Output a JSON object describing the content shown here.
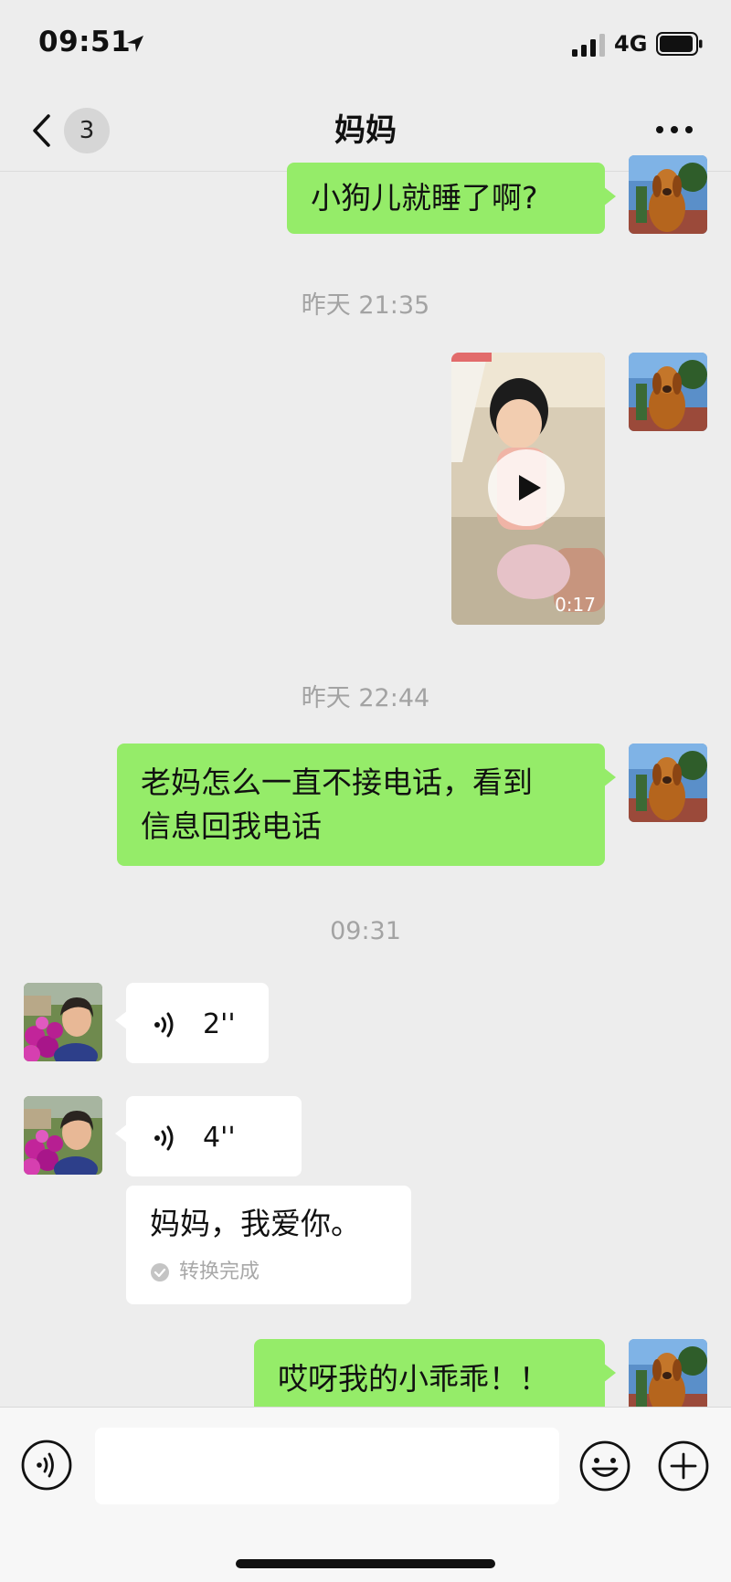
{
  "status_bar": {
    "time": "09:51",
    "network": "4G",
    "icons": [
      "location-arrow-icon",
      "signal-icon",
      "battery-icon"
    ]
  },
  "header": {
    "back_icon": "chevron-left-icon",
    "unread_count": "3",
    "title": "妈妈",
    "more_icon": "more-dots-icon"
  },
  "messages": [
    {
      "type": "text",
      "direction": "out",
      "text": "小狗儿就睡了啊?"
    },
    {
      "type": "timestamp",
      "text": "昨天 21:35"
    },
    {
      "type": "video",
      "direction": "out",
      "duration": "0:17"
    },
    {
      "type": "timestamp",
      "text": "昨天 22:44"
    },
    {
      "type": "text",
      "direction": "out",
      "lines": [
        "老妈怎么一直不接电话，看到",
        "信息回我电话"
      ]
    },
    {
      "type": "timestamp",
      "text": "09:31"
    },
    {
      "type": "voice",
      "direction": "in",
      "duration": "2''"
    },
    {
      "type": "voice",
      "direction": "in",
      "duration": "4''",
      "transcript": "妈妈，我爱你。",
      "transcript_status": "转换完成"
    },
    {
      "type": "text",
      "direction": "out",
      "text": "哎呀我的小乖乖！！"
    }
  ],
  "input_bar": {
    "placeholder": "",
    "icons": [
      "voice-toggle-icon",
      "emoji-icon",
      "plus-icon"
    ]
  },
  "colors": {
    "background": "#ededed",
    "outgoing_bubble": "#95ec69",
    "incoming_bubble": "#ffffff",
    "timestamp": "#a3a3a3"
  }
}
